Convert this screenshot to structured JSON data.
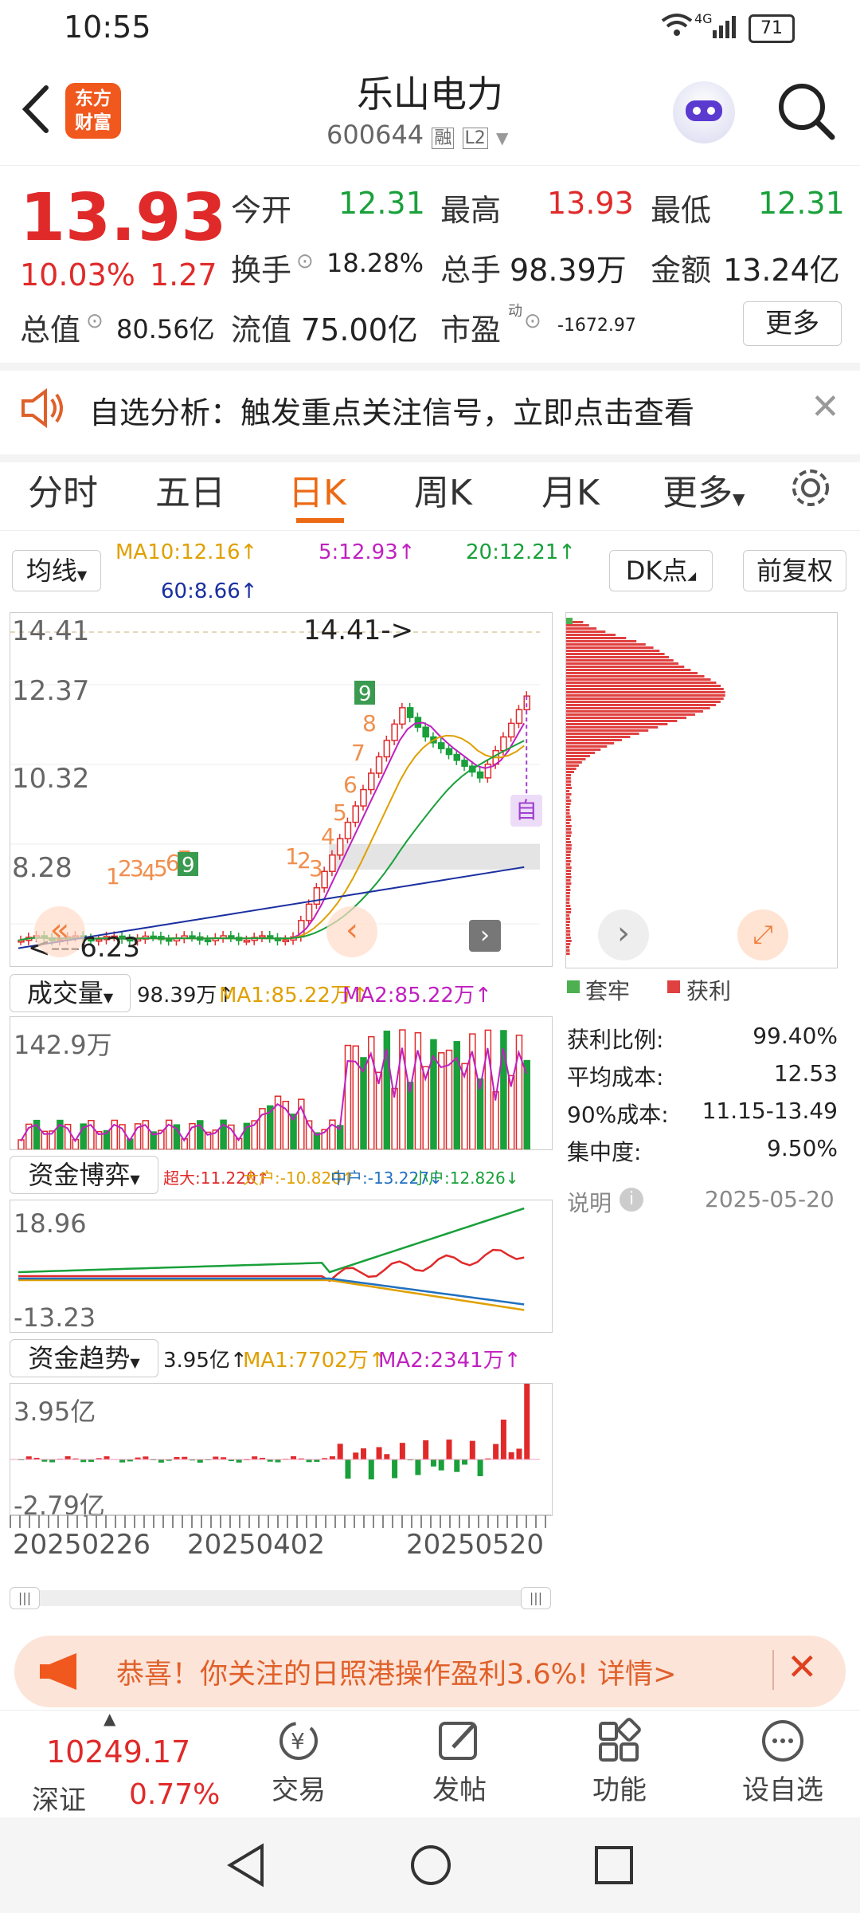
{
  "status": {
    "time": "10:55",
    "network": "4G",
    "battery": "71"
  },
  "header": {
    "logo_line1": "东方",
    "logo_line2": "财富",
    "title": "乐山电力",
    "code": "600644",
    "badge_margin": "融",
    "badge_level": "L2"
  },
  "quote": {
    "price": "13.93",
    "change_pct": "10.03%",
    "change_abs": "1.27",
    "open_label": "今开",
    "open": "12.31",
    "high_label": "最高",
    "high": "13.93",
    "low_label": "最低",
    "low": "12.31",
    "turnover_label": "换手",
    "turnover": "18.28%",
    "volume_label": "总手",
    "volume": "98.39万",
    "amount_label": "金额",
    "amount": "13.24亿",
    "mktcap_label": "总值",
    "mktcap": "80.56亿",
    "float_label": "流值",
    "float": "75.00亿",
    "pe_label": "市盈",
    "pe_sup": "动",
    "pe": "-1672.97",
    "more_button": "更多"
  },
  "notice": {
    "text": "自选分析：触发重点关注信号，立即点击查看"
  },
  "tabs": [
    "分时",
    "五日",
    "日K",
    "周K",
    "月K",
    "更多"
  ],
  "active_tab": "日K",
  "kline": {
    "ma_button": "均线",
    "ma10": "MA10:12.16↑",
    "ma5": "5:12.93↑",
    "ma20": "20:12.21↑",
    "ma60": "60:8.66↑",
    "dk_button": "DK点",
    "adjust_button": "前复权",
    "y_labels": [
      "14.41",
      "12.37",
      "10.32",
      "8.28",
      "6.23"
    ],
    "high_marker": "14.41->",
    "low_marker": "<---6.23",
    "auto_tag": "自",
    "colors": {
      "up": "#e02a2a",
      "down": "#19a03a",
      "ma5": "#c020c0",
      "ma10": "#e0a000",
      "ma20": "#19a03a",
      "ma60": "#1a2fa0"
    }
  },
  "volume": {
    "selector": "成交量",
    "value": "98.39万↑",
    "ma1": "MA1:85.22万↑",
    "ma2": "MA2:85.22万↑",
    "y_top": "142.9万"
  },
  "fund_game": {
    "selector": "资金博弈",
    "super": "超大:11.220↑",
    "large": "大户:-10.820↑",
    "medium": "中户:-13.227↓",
    "small": "小户:12.826↓",
    "y_top": "18.96",
    "y_bottom": "-13.23"
  },
  "fund_trend": {
    "selector": "资金趋势",
    "value": "3.95亿↑",
    "ma1": "MA1:7702万↑",
    "ma2": "MA2:2341万↑",
    "y_top": "3.95亿",
    "y_bottom": "-2.79亿"
  },
  "dates": [
    "20250226",
    "20250402",
    "20250520"
  ],
  "chips": {
    "legend_trapped": "套牢",
    "legend_profit": "获利",
    "rows": [
      {
        "label": "获利比例:",
        "value": "99.40%"
      },
      {
        "label": "平均成本:",
        "value": "12.53"
      },
      {
        "label": "90%成本:",
        "value": "11.15-13.49"
      },
      {
        "label": "集中度:",
        "value": "9.50%"
      }
    ],
    "note_label": "说明",
    "date": "2025-05-20"
  },
  "promo": {
    "text": "恭喜！你关注的日照港操作盈利3.6%! 详情>"
  },
  "bottom_nav": {
    "index_value": "10249.17",
    "index_name": "深证",
    "index_change": "0.77%",
    "items": [
      "交易",
      "发帖",
      "功能",
      "设自选"
    ]
  }
}
